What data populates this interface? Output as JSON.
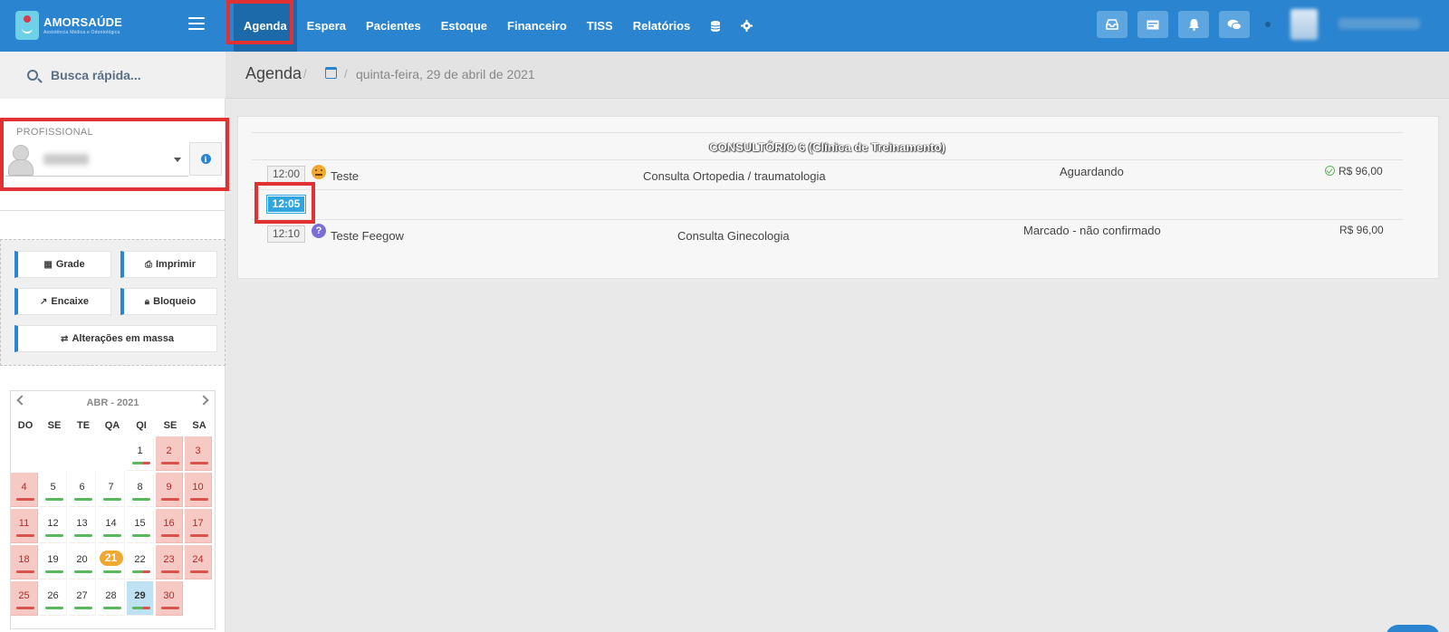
{
  "app": {
    "logo_text": "AMORSAÚDE",
    "logo_sub": "Assistência Médica e Odontológica"
  },
  "nav": {
    "items": [
      "Agenda",
      "Espera",
      "Pacientes",
      "Estoque",
      "Financeiro",
      "TISS",
      "Relatórios"
    ],
    "active": "Agenda",
    "icons": [
      "database-icon",
      "gear-icon"
    ]
  },
  "top_buttons": [
    "inbox-icon",
    "card-icon",
    "bell-icon",
    "chat-icon"
  ],
  "search": {
    "placeholder": "Busca rápida..."
  },
  "sidebar": {
    "professional_label": "PROFISSIONAL",
    "actions": {
      "grade": "Grade",
      "imprimir": "Imprimir",
      "encaixe": "Encaixe",
      "bloqueio": "Bloqueio",
      "alteracoes": "Alterações em massa"
    }
  },
  "calendar": {
    "title": "ABR - 2021",
    "weekdays": [
      "DO",
      "SE",
      "TE",
      "QA",
      "QI",
      "SE",
      "SA"
    ],
    "days": [
      "1",
      "2",
      "3",
      "4",
      "5",
      "6",
      "7",
      "8",
      "9",
      "10",
      "11",
      "12",
      "13",
      "14",
      "15",
      "16",
      "17",
      "18",
      "19",
      "20",
      "21",
      "22",
      "23",
      "24",
      "25",
      "26",
      "27",
      "28",
      "29",
      "30"
    ],
    "today": "21",
    "selected": "29"
  },
  "breadcrumb": {
    "title": "Agenda",
    "separator": "/",
    "date": "quinta-feira, 29 de abril de 2021"
  },
  "schedule": {
    "room": "CONSULTÓRIO 6 (Clínica de Treinamento)",
    "slots": [
      {
        "time": "12:00",
        "patient": "Teste",
        "procedure": "Consulta Ortopedia / traumatologia",
        "status": "Aguardando",
        "price": "R$ 96,00",
        "paid": true,
        "icon": "emoji-neutral-icon"
      },
      {
        "time": "12:05",
        "patient": "",
        "procedure": "",
        "status": "",
        "price": "",
        "paid": false,
        "icon": ""
      },
      {
        "time": "12:10",
        "patient": "Teste Feegow",
        "procedure": "Consulta Ginecologia",
        "status": "Marcado - não confirmado",
        "price": "R$ 96,00",
        "paid": false,
        "icon": "question-icon"
      }
    ]
  },
  "colors": {
    "topbar": "#2a84cf",
    "active_nav": "#1c6aa9",
    "highlight": "#e03232",
    "active_time": "#31a5e0",
    "weekend": "#f6c9c4",
    "today": "#f0a830"
  }
}
